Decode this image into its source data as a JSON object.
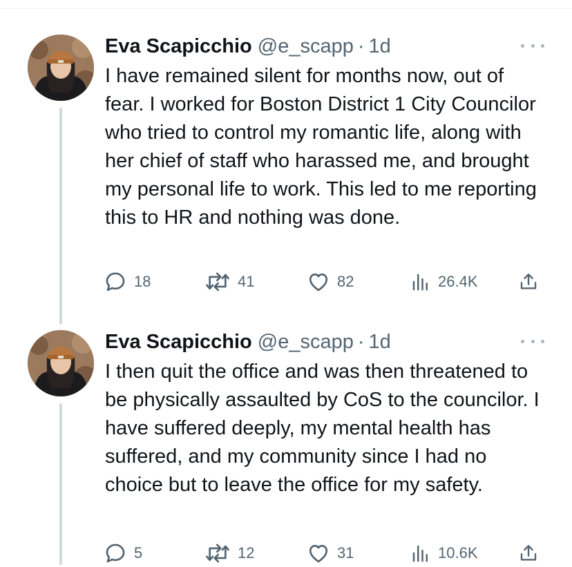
{
  "colors": {
    "text": "#0f1419",
    "muted": "#536471",
    "thread_line": "#cfd9de"
  },
  "tweets": [
    {
      "author": "Eva Scapicchio",
      "handle": "@e_scapp",
      "separator": "·",
      "time": "1d",
      "text": "I have remained silent for months now, out of fear. I worked for Boston District 1 City Councilor who tried to control my romantic life, along with her chief of staff who harassed me, and brought my personal life to work. This led to me reporting this to HR and nothing was done.",
      "replies": "18",
      "retweets": "41",
      "likes": "82",
      "views": "26.4K"
    },
    {
      "author": "Eva Scapicchio",
      "handle": "@e_scapp",
      "separator": "·",
      "time": "1d",
      "text": "I then quit the office and was then threatened to be physically assaulted by CoS to the councilor. I have suffered deeply, my mental health has suffered, and my community since I had no choice but to leave the office for my safety.",
      "replies": "5",
      "retweets": "12",
      "likes": "31",
      "views": "10.6K"
    }
  ],
  "icons": {
    "reply": "reply-icon",
    "retweet": "retweet-icon",
    "like": "heart-icon",
    "views": "views-icon",
    "share": "share-icon",
    "more": "more-icon"
  }
}
